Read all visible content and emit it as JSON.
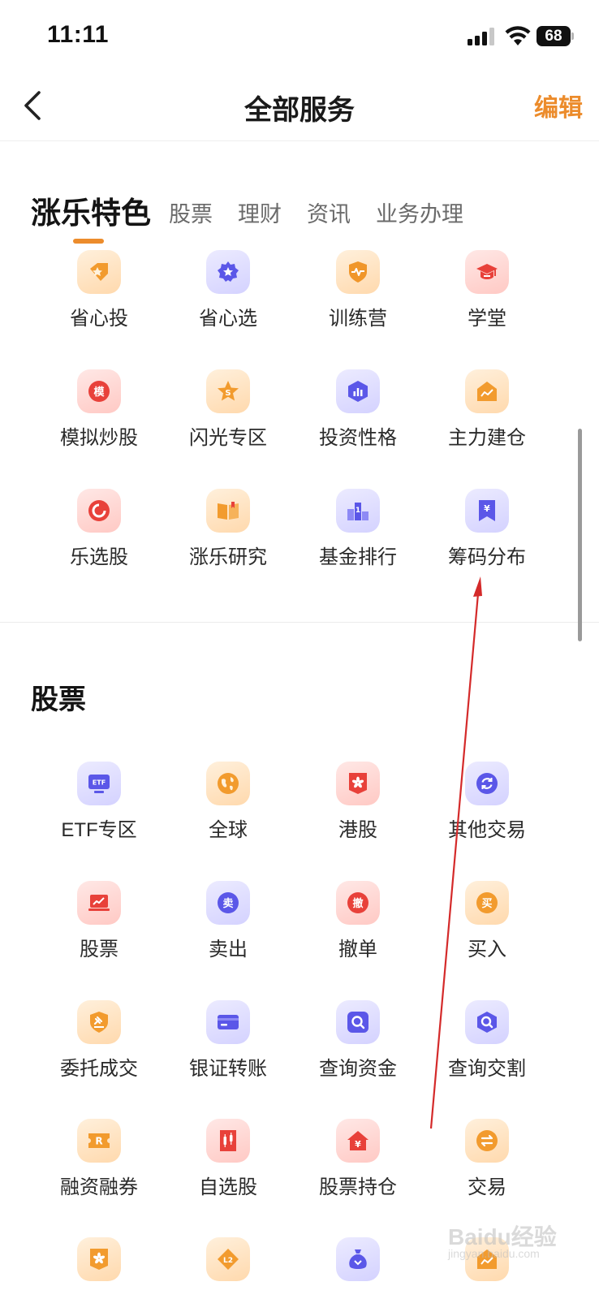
{
  "status_bar": {
    "time": "11:11",
    "battery_level": "68"
  },
  "nav": {
    "title": "全部服务",
    "edit_label": "编辑"
  },
  "tabs": [
    {
      "label": "涨乐特色",
      "active": true
    },
    {
      "label": "股票",
      "active": false
    },
    {
      "label": "理财",
      "active": false
    },
    {
      "label": "资讯",
      "active": false
    },
    {
      "label": "业务办理",
      "active": false
    }
  ],
  "featured": {
    "items": [
      {
        "label": "省心投",
        "icon": "gem-tag-icon"
      },
      {
        "label": "省心选",
        "icon": "star-badge-icon"
      },
      {
        "label": "训练营",
        "icon": "shield-pulse-icon"
      },
      {
        "label": "学堂",
        "icon": "graduation-cap-icon"
      },
      {
        "label": "模拟炒股",
        "icon": "mo-character-icon",
        "glyph": "模"
      },
      {
        "label": "闪光专区",
        "icon": "star-s-icon"
      },
      {
        "label": "投资性格",
        "icon": "hexagon-bars-icon"
      },
      {
        "label": "主力建仓",
        "icon": "trend-card-icon"
      },
      {
        "label": "乐选股",
        "icon": "pie-ring-icon"
      },
      {
        "label": "涨乐研究",
        "icon": "open-book-icon"
      },
      {
        "label": "基金排行",
        "icon": "podium-icon",
        "glyph": "1"
      },
      {
        "label": "筹码分布",
        "icon": "yen-bookmark-icon",
        "glyph": "¥"
      }
    ]
  },
  "stocks": {
    "title": "股票",
    "items": [
      {
        "label": "ETF专区",
        "icon": "etf-monitor-icon",
        "glyph": "ETF"
      },
      {
        "label": "全球",
        "icon": "globe-icon"
      },
      {
        "label": "港股",
        "icon": "hk-flag-icon"
      },
      {
        "label": "其他交易",
        "icon": "refresh-circle-icon"
      },
      {
        "label": "股票",
        "icon": "trend-laptop-icon"
      },
      {
        "label": "卖出",
        "icon": "sell-badge-icon",
        "glyph": "卖"
      },
      {
        "label": "撤单",
        "icon": "cancel-badge-icon",
        "glyph": "撤"
      },
      {
        "label": "买入",
        "icon": "buy-badge-icon",
        "glyph": "买"
      },
      {
        "label": "委托成交",
        "icon": "gavel-shield-icon"
      },
      {
        "label": "银证转账",
        "icon": "bank-card-icon"
      },
      {
        "label": "查询资金",
        "icon": "search-square-icon"
      },
      {
        "label": "查询交割",
        "icon": "search-hexagon-icon"
      },
      {
        "label": "融资融券",
        "icon": "r-ticket-icon",
        "glyph": "R"
      },
      {
        "label": "自选股",
        "icon": "candlestick-icon"
      },
      {
        "label": "股票持仓",
        "icon": "yen-house-icon",
        "glyph": "¥"
      },
      {
        "label": "交易",
        "icon": "exchange-arrows-icon"
      },
      {
        "icon": "hk-flag-shield-icon"
      },
      {
        "icon": "l2-diamond-icon",
        "glyph": "L2"
      },
      {
        "icon": "money-bag-icon"
      },
      {
        "icon": "trend-card-icon"
      }
    ]
  },
  "colors": {
    "accent": "#ec8c2c",
    "annotation_arrow": "#d42a2a"
  },
  "watermark": {
    "brand": "Baidu经验",
    "url": "jingyan.baidu.com"
  }
}
